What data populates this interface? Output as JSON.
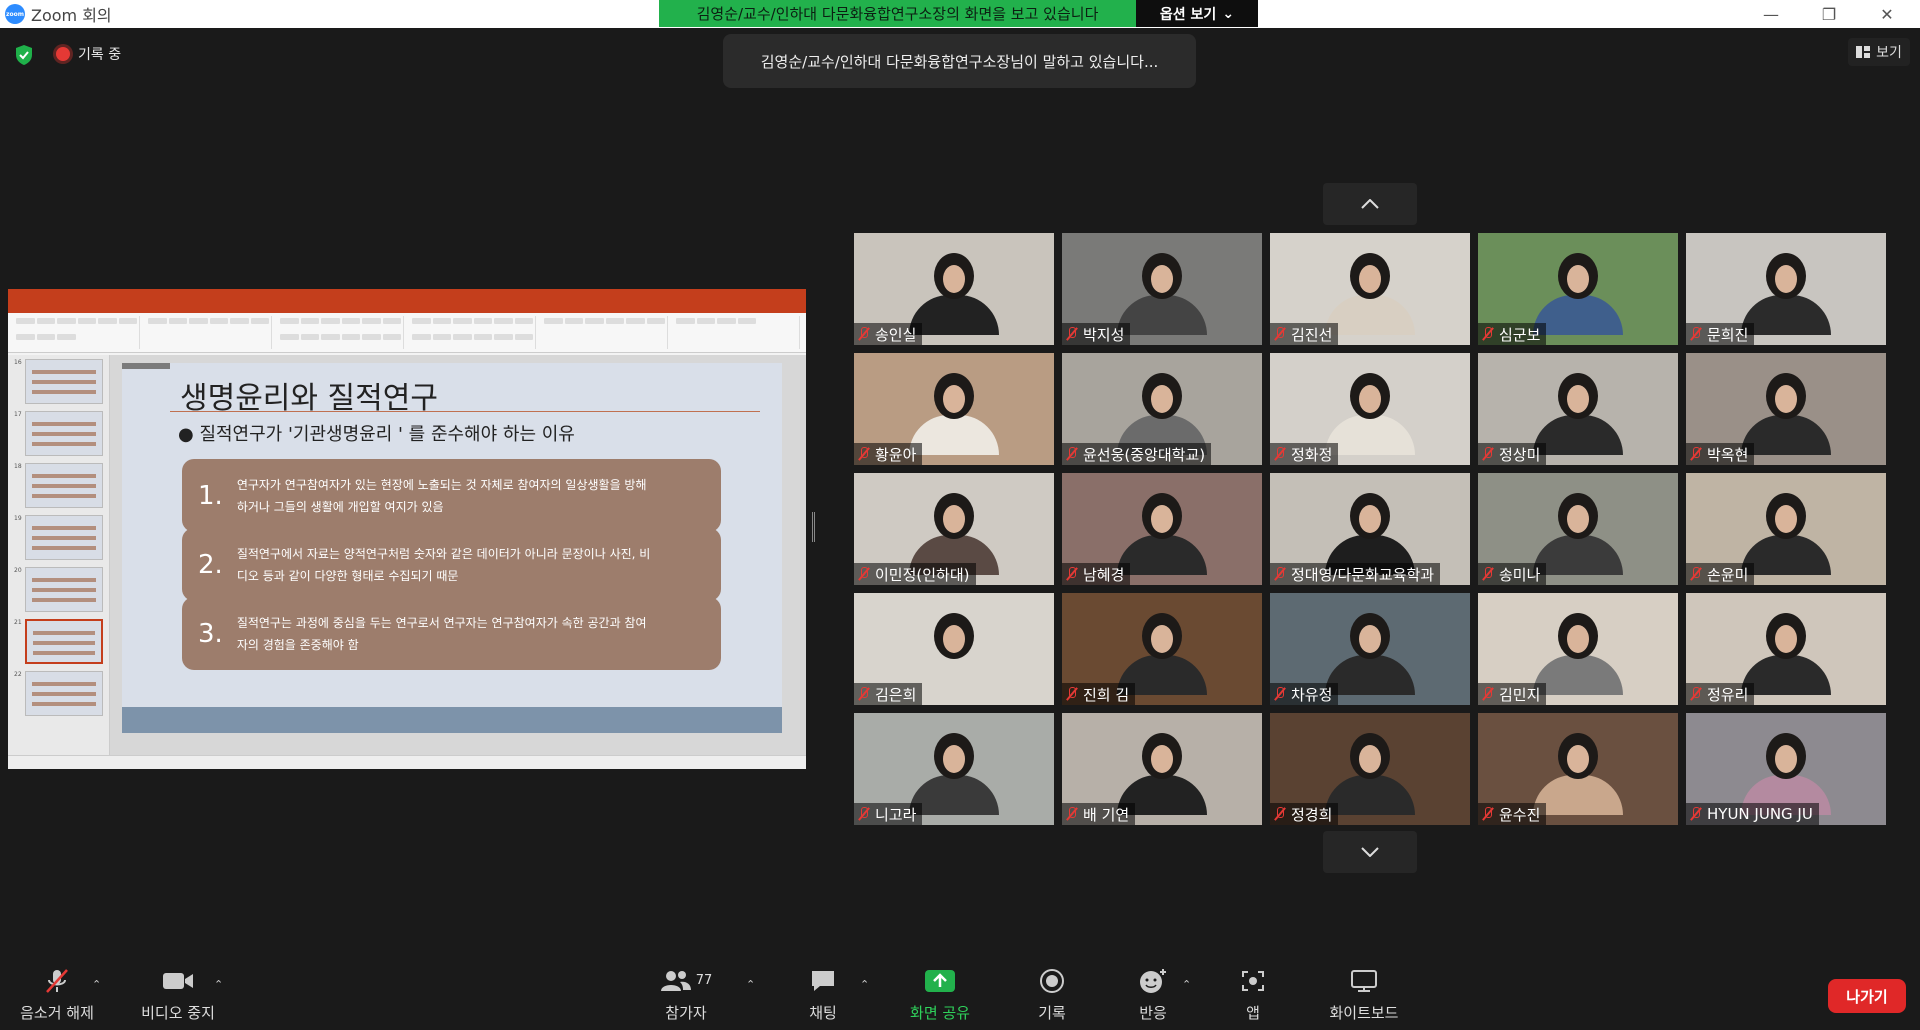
{
  "window": {
    "title": "Zoom 회의",
    "logo_text": "zoom"
  },
  "share_banner": {
    "text": "김영순/교수/인하대 다문화융합연구소장의 화면을 보고 있습니다",
    "options_label": "옵션 보기"
  },
  "meeting": {
    "recording_label": "기록 중",
    "speaker_toast": "김영순/교수/인하대 다문화융합연구소장님이 말하고 있습니다...",
    "view_label": "보기"
  },
  "slide": {
    "title": "생명윤리와 질적연구",
    "bullet": "질적연구가 '기관생명윤리 ' 를 준수해야 하는 이유",
    "points": [
      {
        "num": "1.",
        "text_line1": "연구자가 연구참여자가 있는 현장에 노출되는 것 자체로 참여자의 일상생활을 방해",
        "text_line2": "하거나 그들의 생활에 개입할 여지가 있음"
      },
      {
        "num": "2.",
        "text_line1": "질적연구에서 자료는 양적연구처럼 숫자와 같은 데이터가 아니라 문장이나 사진, 비",
        "text_line2": "디오 등과 같이 다양한 형태로 수집되기 때문"
      },
      {
        "num": "3.",
        "text_line1": "질적연구는 과정에 중심을 두는 연구로서 연구자는 연구참여자가 속한 공간과 참여",
        "text_line2": "자의 경험을 존중해야 함"
      }
    ],
    "thumb_numbers": [
      "16",
      "17",
      "18",
      "19",
      "20",
      "21",
      "22"
    ]
  },
  "participants": [
    {
      "name": "송인실",
      "bg": "#c9c4bc",
      "shirt": "#222"
    },
    {
      "name": "박지성",
      "bg": "#7a7a78",
      "shirt": "#444"
    },
    {
      "name": "김진선",
      "bg": "#d6d2cb",
      "shirt": "#d8cfc2"
    },
    {
      "name": "심군보",
      "bg": "#6b8f5a",
      "shirt": "#3f5f8c"
    },
    {
      "name": "문희진",
      "bg": "#c8c5c0",
      "shirt": "#2b2b2b"
    },
    {
      "name": "황윤아",
      "bg": "#b99c83",
      "shirt": "#ece7df"
    },
    {
      "name": "윤선웅(중앙대학교)",
      "bg": "#a8a49d",
      "shirt": "#6b6b6b"
    },
    {
      "name": "정화정",
      "bg": "#d4d0ca",
      "shirt": "#e6e1d8"
    },
    {
      "name": "정상미",
      "bg": "#b7b3ac",
      "shirt": "#2a2a2a"
    },
    {
      "name": "박옥현",
      "bg": "#9a9088",
      "shirt": "#2a2a2a"
    },
    {
      "name": "이민정(인하대)",
      "bg": "#cfcac3",
      "shirt": "#5a4a44"
    },
    {
      "name": "남혜경",
      "bg": "#8a6f69",
      "shirt": "#2a2a2a"
    },
    {
      "name": "정대영/다문화교육학과",
      "bg": "#c4bfb7",
      "shirt": "#1e1e1e"
    },
    {
      "name": "송미나",
      "bg": "#8e9086",
      "shirt": "#3b3b3b"
    },
    {
      "name": "손윤미",
      "bg": "#bfb4a4",
      "shirt": "#2a2a2a"
    },
    {
      "name": "김은희",
      "bg": "#d8d4cd",
      "shirt": "#d8d4cd"
    },
    {
      "name": "진희 김",
      "bg": "#6a4a32",
      "shirt": "#2a2a2a"
    },
    {
      "name": "차유정",
      "bg": "#5d6a72",
      "shirt": "#2a2a2a"
    },
    {
      "name": "김민지",
      "bg": "#d7cfc4",
      "shirt": "#7a7a7a"
    },
    {
      "name": "정유리",
      "bg": "#cfc6bb",
      "shirt": "#2a2a2a"
    },
    {
      "name": "니고라",
      "bg": "#a9aca8",
      "shirt": "#3a3a3a"
    },
    {
      "name": "배 기연",
      "bg": "#b7b0a8",
      "shirt": "#222"
    },
    {
      "name": "정경희",
      "bg": "#5a4232",
      "shirt": "#2a2a2a"
    },
    {
      "name": "윤수진",
      "bg": "#6a5040",
      "shirt": "#c9a78c"
    },
    {
      "name": "HYUN JUNG JU",
      "bg": "#8d8a90",
      "shirt": "#b48aa0"
    }
  ],
  "toolbar": {
    "unmute": "음소거 해제",
    "video": "비디오 중지",
    "participants": "참가자",
    "participant_count": "77",
    "chat": "채팅",
    "share": "화면 공유",
    "record": "기록",
    "reactions": "반응",
    "apps": "앱",
    "whiteboard": "화이트보드",
    "leave": "나가기"
  },
  "colors": {
    "share_green": "#22b14c",
    "leave_red": "#e02828",
    "recording_red": "#e53935",
    "active_green": "#2fd15b"
  }
}
